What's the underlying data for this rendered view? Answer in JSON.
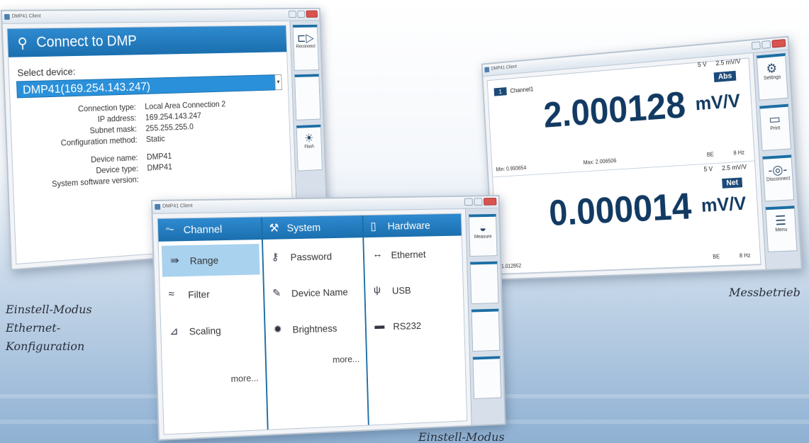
{
  "captions": {
    "left": [
      "Einstell-Modus",
      "Ethernet-",
      "Konfiguration"
    ],
    "right": "Messbetrieb",
    "bottom": "Einstell-Modus"
  },
  "connect_window": {
    "title_bar": "DMP41 Client",
    "header": "Connect to DMP",
    "select_label": "Select device:",
    "selected_device": "DMP41(169.254.143.247)",
    "details_network": [
      {
        "key": "Connection type:",
        "value": "Local Area Connection 2"
      },
      {
        "key": "IP address:",
        "value": "169.254.143.247"
      },
      {
        "key": "Subnet mask:",
        "value": "255.255.255.0"
      },
      {
        "key": "Configuration method:",
        "value": "Static"
      }
    ],
    "details_device": [
      {
        "key": "Device name:",
        "value": "DMP41"
      },
      {
        "key": "Device type:",
        "value": "DMP41"
      },
      {
        "key": "System software version:",
        "value": ""
      }
    ],
    "sidebar": [
      {
        "label": "Reconnect",
        "icon": "plug-icon"
      },
      {
        "label": "",
        "icon": ""
      },
      {
        "label": "Flash",
        "icon": "flash-icon"
      }
    ]
  },
  "measure_window": {
    "title_bar": "DMP41 Client",
    "channels": [
      {
        "number": "1",
        "name": "Channel1",
        "value": "2.000128",
        "unit": "mV/V",
        "mode": "Abs",
        "excitation": "5 V",
        "range": "2.5 mV/V",
        "min": "Min: 0.993654",
        "max": "Max: 2.006506",
        "filter": "BE",
        "rate": "8 Hz"
      },
      {
        "number": "",
        "name": "",
        "value": "0.000014",
        "unit": "mV/V",
        "mode": "Net",
        "excitation": "5 V",
        "range": "2.5 mV/V",
        "min": "1.012852",
        "max": "",
        "filter": "BE",
        "rate": "8 Hz"
      }
    ],
    "sidebar": [
      {
        "label": "Settings",
        "icon": "gear-icon"
      },
      {
        "label": "Print",
        "icon": "monitor-icon"
      },
      {
        "label": "Disconnect",
        "icon": "disconnect-icon"
      },
      {
        "label": "Menu",
        "icon": "menu-icon"
      }
    ]
  },
  "menu_window": {
    "title_bar": "DMP41 Client",
    "columns": [
      {
        "header": "Channel",
        "icon": "channel-icon",
        "items": [
          {
            "label": "Range",
            "icon": "range-icon",
            "active": true
          },
          {
            "label": "Filter",
            "icon": "filter-icon",
            "active": false
          },
          {
            "label": "Scaling",
            "icon": "scaling-icon",
            "active": false
          }
        ],
        "more": "more..."
      },
      {
        "header": "System",
        "icon": "wrench-icon",
        "items": [
          {
            "label": "Password",
            "icon": "key-icon",
            "active": false
          },
          {
            "label": "Device Name",
            "icon": "tag-icon",
            "active": false
          },
          {
            "label": "Brightness",
            "icon": "brightness-icon",
            "active": false
          }
        ],
        "more": "more..."
      },
      {
        "header": "Hardware",
        "icon": "hardware-icon",
        "items": [
          {
            "label": "Ethernet",
            "icon": "ethernet-icon",
            "active": false
          },
          {
            "label": "USB",
            "icon": "usb-icon",
            "active": false
          },
          {
            "label": "RS232",
            "icon": "serial-icon",
            "active": false
          }
        ],
        "more": ""
      }
    ],
    "sidebar": [
      {
        "label": "Measure",
        "icon": "gauge-icon"
      },
      {
        "label": "",
        "icon": ""
      },
      {
        "label": "",
        "icon": ""
      },
      {
        "label": "",
        "icon": ""
      }
    ]
  }
}
